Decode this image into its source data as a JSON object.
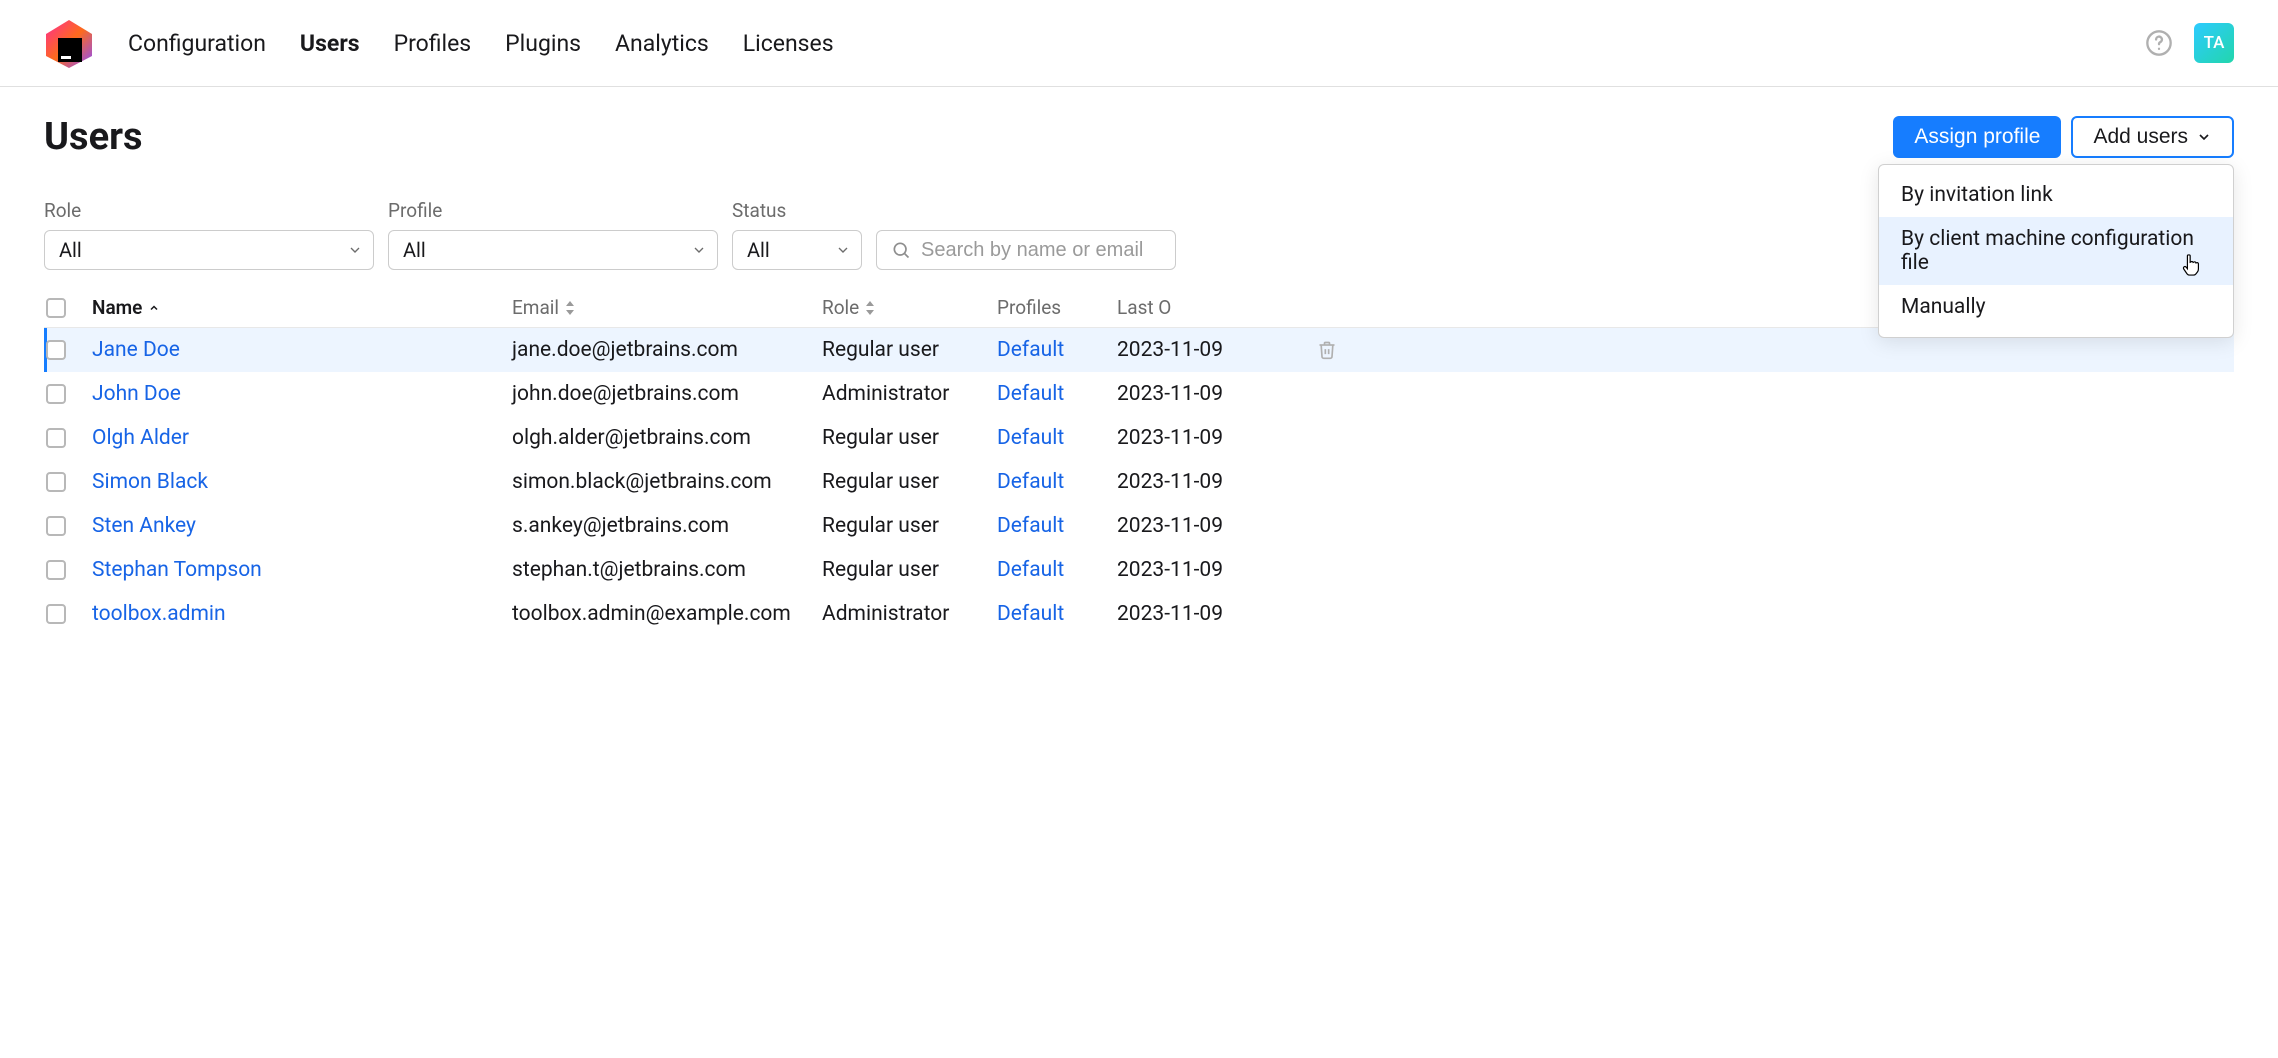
{
  "header": {
    "nav": [
      "Configuration",
      "Users",
      "Profiles",
      "Plugins",
      "Analytics",
      "Licenses"
    ],
    "active_index": 1,
    "avatar_initials": "TA"
  },
  "page": {
    "title": "Users",
    "assign_profile_label": "Assign profile",
    "add_users_label": "Add users"
  },
  "add_users_menu": {
    "items": [
      "By invitation link",
      "By client machine configuration file",
      "Manually"
    ],
    "hover_index": 1
  },
  "filters": {
    "role": {
      "label": "Role",
      "value": "All"
    },
    "profile": {
      "label": "Profile",
      "value": "All"
    },
    "status": {
      "label": "Status",
      "value": "All"
    },
    "search_placeholder": "Search by name or email"
  },
  "table": {
    "columns": {
      "name": "Name",
      "email": "Email",
      "role": "Role",
      "profiles": "Profiles",
      "last": "Last O"
    },
    "rows": [
      {
        "name": "Jane Doe",
        "email": "jane.doe@jetbrains.com",
        "role": "Regular user",
        "profile": "Default",
        "last": "2023-11-09",
        "hover": true
      },
      {
        "name": "John Doe",
        "email": "john.doe@jetbrains.com",
        "role": "Administrator",
        "profile": "Default",
        "last": "2023-11-09"
      },
      {
        "name": "Olgh Alder",
        "email": "olgh.alder@jetbrains.com",
        "role": "Regular user",
        "profile": "Default",
        "last": "2023-11-09"
      },
      {
        "name": "Simon Black",
        "email": "simon.black@jetbrains.com",
        "role": "Regular user",
        "profile": "Default",
        "last": "2023-11-09"
      },
      {
        "name": "Sten Ankey",
        "email": "s.ankey@jetbrains.com",
        "role": "Regular user",
        "profile": "Default",
        "last": "2023-11-09"
      },
      {
        "name": "Stephan Tompson",
        "email": "stephan.t@jetbrains.com",
        "role": "Regular user",
        "profile": "Default",
        "last": "2023-11-09"
      },
      {
        "name": "toolbox.admin",
        "email": "toolbox.admin@example.com",
        "role": "Administrator",
        "profile": "Default",
        "last": "2023-11-09"
      }
    ]
  }
}
